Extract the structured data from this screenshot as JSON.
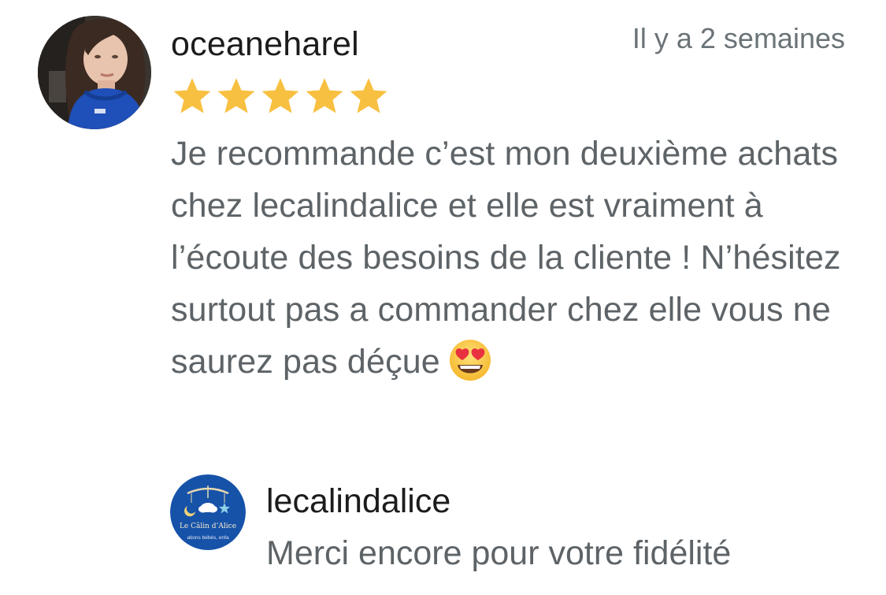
{
  "review": {
    "author": "oceaneharel",
    "timestamp": "Il y a 2 semaines",
    "rating": 5,
    "rating_max": 5,
    "star_color": "#F8C041",
    "text": "Je recommande c’est mon deuxième achats chez lecalindalice et elle est vraiment à l’écoute des besoins de la cliente ! N’hésitez surtout pas a commander chez elle vous ne saurez pas déçue",
    "emoji": "heart-eyes-emoji"
  },
  "reply": {
    "author": "lecalindalice",
    "text": "Merci encore pour votre fidélité",
    "logo": {
      "brand_color": "#1652A8",
      "title": "Le Câlin d’Alice",
      "subtitle": "ations bébés, enfa"
    }
  }
}
